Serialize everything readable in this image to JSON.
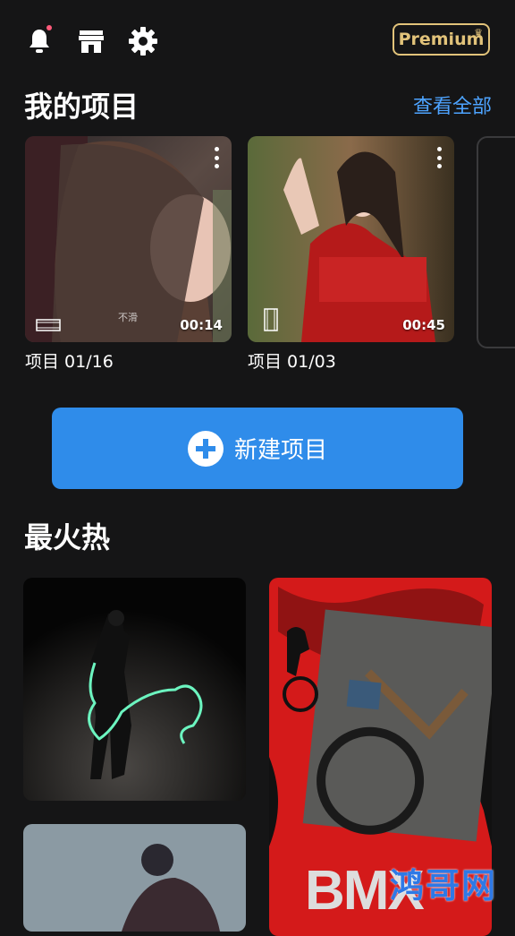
{
  "header": {
    "premium_label": "Premium",
    "icons": [
      "bell-icon",
      "store-icon",
      "gear-icon",
      "crown-icon"
    ],
    "notification_dot_color": "#ff5a7a"
  },
  "my_projects": {
    "title": "我的项目",
    "view_all": "查看全部",
    "items": [
      {
        "label": "项目 01/16",
        "duration": "00:14",
        "thumb_text": "不滑"
      },
      {
        "label": "项目 01/03",
        "duration": "00:45"
      }
    ]
  },
  "new_project": {
    "label": "新建项目"
  },
  "hot": {
    "title": "最火热",
    "watermark_text": "BMX",
    "site_logo": "鸿哥网"
  },
  "colors": {
    "background": "#151516",
    "accent_blue": "#2f8cea",
    "link_blue": "#4da3ff",
    "premium_gold": "#e2c37a"
  }
}
